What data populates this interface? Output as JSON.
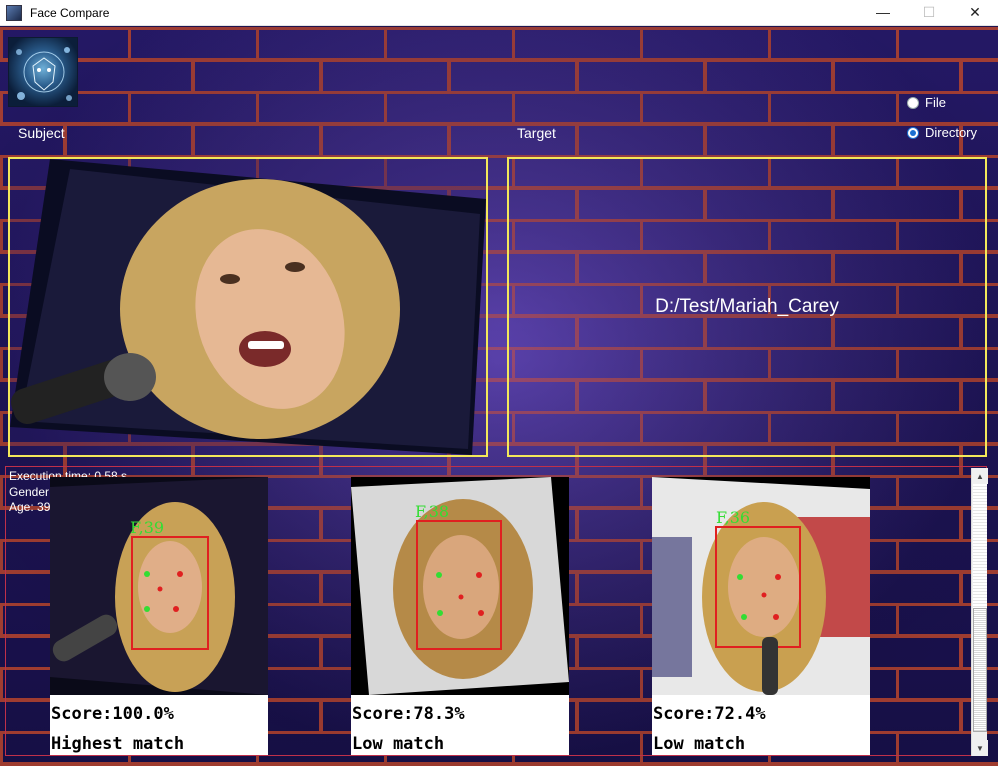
{
  "window": {
    "title": "Face Compare"
  },
  "labels": {
    "subject": "Subject",
    "target": "Target"
  },
  "mode": {
    "options": [
      {
        "label": "File",
        "selected": false
      },
      {
        "label": "Directory",
        "selected": true
      }
    ]
  },
  "target": {
    "path": "D:/Test/Mariah_Carey"
  },
  "execution": {
    "time": "Execution time: 0.58 s",
    "gender": "Gender",
    "age": "Age: 39"
  },
  "results": [
    {
      "face_tag": "F,39",
      "score": "Score:100.0%",
      "match": "Highest match"
    },
    {
      "face_tag": "F,38",
      "score": "Score:78.3%",
      "match": "Low match"
    },
    {
      "face_tag": "F,36",
      "score": "Score:72.4%",
      "match": "Low match"
    }
  ],
  "colors": {
    "panel_border": "#f3e85a",
    "face_box": "#e02020",
    "face_tag": "#33dd33",
    "results_border": "#c0304a"
  }
}
